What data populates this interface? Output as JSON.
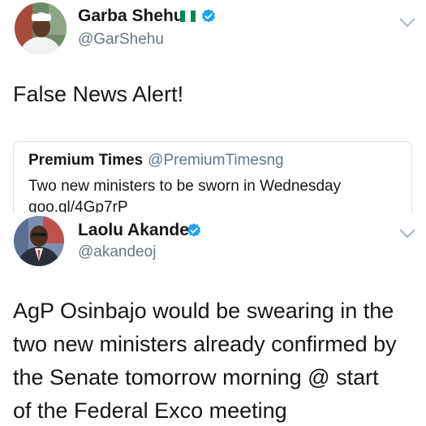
{
  "tweet1": {
    "author_name": "Garba Shehu",
    "author_handle": "@GarShehu",
    "flag_colors": [
      "#008751",
      "#ffffff",
      "#008751"
    ],
    "verified_icon": "verified-badge-icon",
    "menu_icon": "chevron-down-icon",
    "text": "False News Alert!",
    "quoted": {
      "author_name": "Premium Times",
      "author_handle": "@PremiumTimesng",
      "text": "Two new ministers to be sworn in Wednesday",
      "link": "goo.gl/4Gp7rP"
    }
  },
  "tweet2": {
    "author_name": "Laolu Akande",
    "author_handle": "@akandeoj",
    "verified_icon": "verified-badge-icon",
    "menu_icon": "chevron-down-icon",
    "text_lines": [
      "AgP Osinbajo would be swearing in the",
      "two new ministers already confirmed by",
      "the Senate tomorrow morning @ start",
      "of the Federal Exco meeting"
    ]
  },
  "colors": {
    "verified_blue": "#1da1f2",
    "secondary_text": "#657786",
    "primary_text": "#14171a",
    "card_border": "#d8dee3"
  }
}
